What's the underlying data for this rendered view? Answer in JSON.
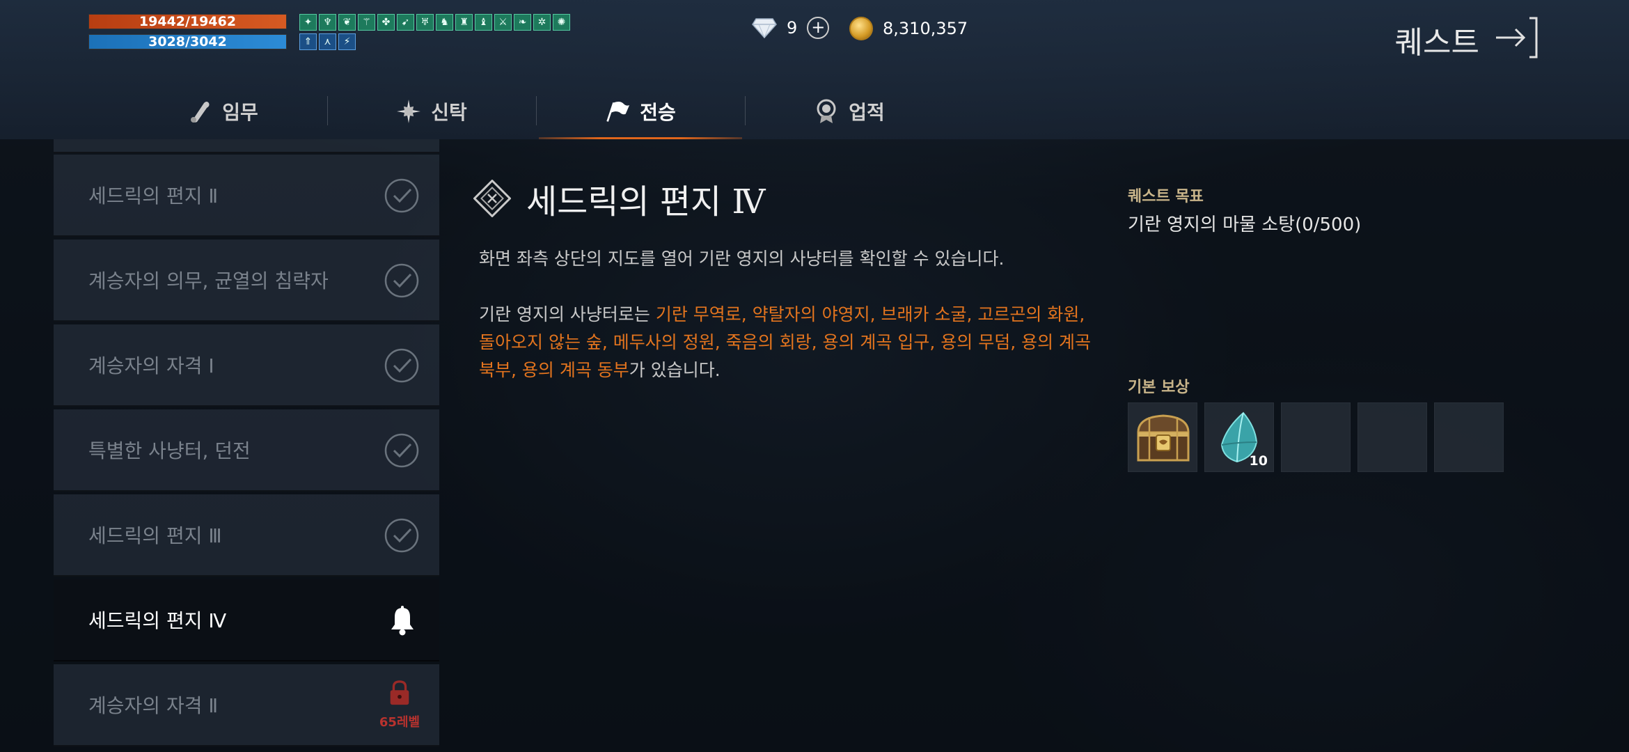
{
  "status": {
    "hp": "19442/19462",
    "mp": "3028/3042",
    "hp_fraction": 0.999,
    "mp_fraction": 0.995,
    "buff_icons_row1": [
      "buff",
      "buff",
      "buff",
      "buff",
      "buff",
      "buff",
      "buff",
      "buff",
      "buff",
      "buff",
      "buff",
      "buff",
      "buff",
      "buff",
      "buff",
      "buff",
      "buff",
      "buff",
      "buff",
      "buff"
    ],
    "buff_icons_row2": [
      "buff",
      "buff",
      "buff"
    ]
  },
  "currency": {
    "gems": "9",
    "gold": "8,310,357"
  },
  "header": {
    "title": "퀘스트"
  },
  "tabs": [
    {
      "label": "임무",
      "icon": "scroll-icon"
    },
    {
      "label": "신탁",
      "icon": "star-burst-icon"
    },
    {
      "label": "전승",
      "icon": "flag-icon",
      "active": true
    },
    {
      "label": "업적",
      "icon": "medal-icon"
    }
  ],
  "quest_list": [
    {
      "label": "세드릭의 편지 Ⅱ",
      "state": "completed"
    },
    {
      "label": "계승자의 의무, 균열의 침략자",
      "state": "completed"
    },
    {
      "label": "계승자의 자격 Ⅰ",
      "state": "completed"
    },
    {
      "label": "특별한 사냥터, 던전",
      "state": "completed"
    },
    {
      "label": "세드릭의 편지 Ⅲ",
      "state": "completed"
    },
    {
      "label": "세드릭의 편지 Ⅳ",
      "state": "active"
    },
    {
      "label": "계승자의 자격 Ⅱ",
      "state": "locked",
      "lock_label": "65레벨"
    }
  ],
  "detail": {
    "title": "세드릭의 편지 Ⅳ",
    "desc1": "화면 좌측 상단의 지도를 열어 기란 영지의 사냥터를 확인할 수 있습니다.",
    "desc2_pre": "기란 영지의 사냥터로는 ",
    "desc2_highlight": "기란 무역로, 약탈자의 야영지, 브래카 소굴, 고르곤의 화원, 돌아오지 않는 숲, 메두사의 정원, 죽음의 회랑, 용의 계곡 입구, 용의 무덤, 용의 계곡 북부, 용의 계곡 동부",
    "desc2_post": "가 있습니다."
  },
  "goal": {
    "label": "퀘스트 목표",
    "text": "기란 영지의 마물 소탕(0/500)"
  },
  "rewards": {
    "label": "기본 보상",
    "items": [
      {
        "icon": "treasure-chest-icon",
        "count": ""
      },
      {
        "icon": "crystal-icon",
        "count": "10"
      },
      {
        "icon": "",
        "count": ""
      },
      {
        "icon": "",
        "count": ""
      },
      {
        "icon": "",
        "count": ""
      }
    ]
  },
  "colors": {
    "hp": "#d65a22",
    "mp": "#2c8bd6",
    "accent": "#e0661c",
    "highlight_text": "#e3741e",
    "lock": "#b8322e"
  }
}
